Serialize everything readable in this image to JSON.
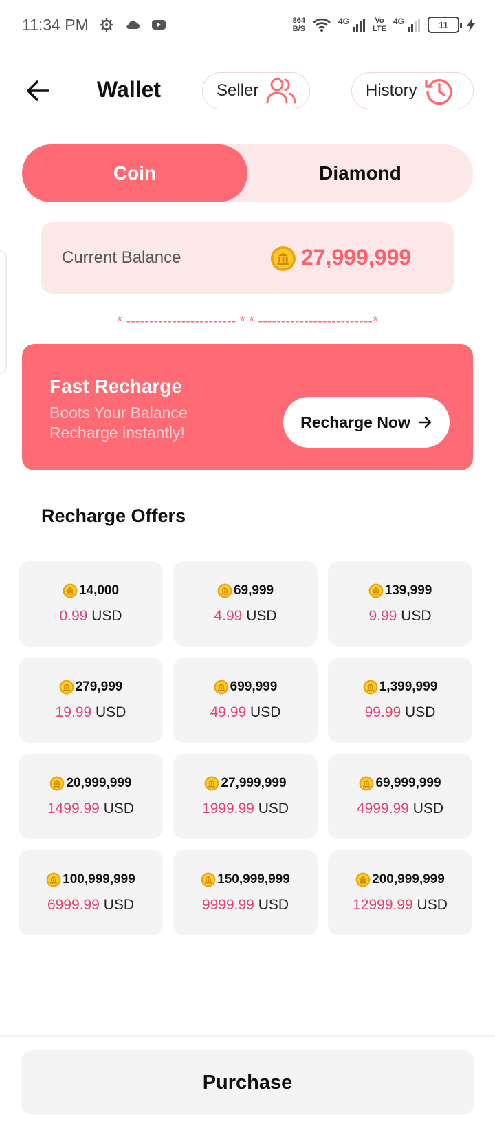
{
  "status_bar": {
    "time": "11:34 PM",
    "net_speed_value": "864",
    "net_speed_unit": "B/S",
    "net1": "4G",
    "volte1": "Vo",
    "volte2": "LTE",
    "net2": "4G",
    "battery": "11"
  },
  "header": {
    "title": "Wallet",
    "seller_label": "Seller",
    "history_label": "History"
  },
  "tabs": [
    {
      "label": "Coin",
      "active": true
    },
    {
      "label": "Diamond",
      "active": false
    }
  ],
  "balance": {
    "label": "Current Balance",
    "value": "27,999,999"
  },
  "divider_text": "* ------------------------ * * -------------------------*",
  "fast_recharge": {
    "title": "Fast Recharge",
    "line1": "Boots Your Balance",
    "line2": "Recharge instantly!",
    "button_label": "Recharge Now"
  },
  "offers_title": "Recharge Offers",
  "currency": "USD",
  "offers": [
    {
      "coins": "14,000",
      "price": "0.99"
    },
    {
      "coins": "69,999",
      "price": "4.99"
    },
    {
      "coins": "139,999",
      "price": "9.99"
    },
    {
      "coins": "279,999",
      "price": "19.99"
    },
    {
      "coins": "699,999",
      "price": "49.99"
    },
    {
      "coins": "1,399,999",
      "price": "99.99"
    },
    {
      "coins": "20,999,999",
      "price": "1499.99"
    },
    {
      "coins": "27,999,999",
      "price": "1999.99"
    },
    {
      "coins": "69,999,999",
      "price": "4999.99"
    },
    {
      "coins": "100,999,999",
      "price": "6999.99"
    },
    {
      "coins": "150,999,999",
      "price": "9999.99"
    },
    {
      "coins": "200,999,999",
      "price": "12999.99"
    }
  ],
  "purchase_label": "Purchase",
  "colors": {
    "accent": "#ff6b74",
    "accent_light": "#fde8e9",
    "price": "#e04470",
    "card": "#f4f4f4"
  }
}
